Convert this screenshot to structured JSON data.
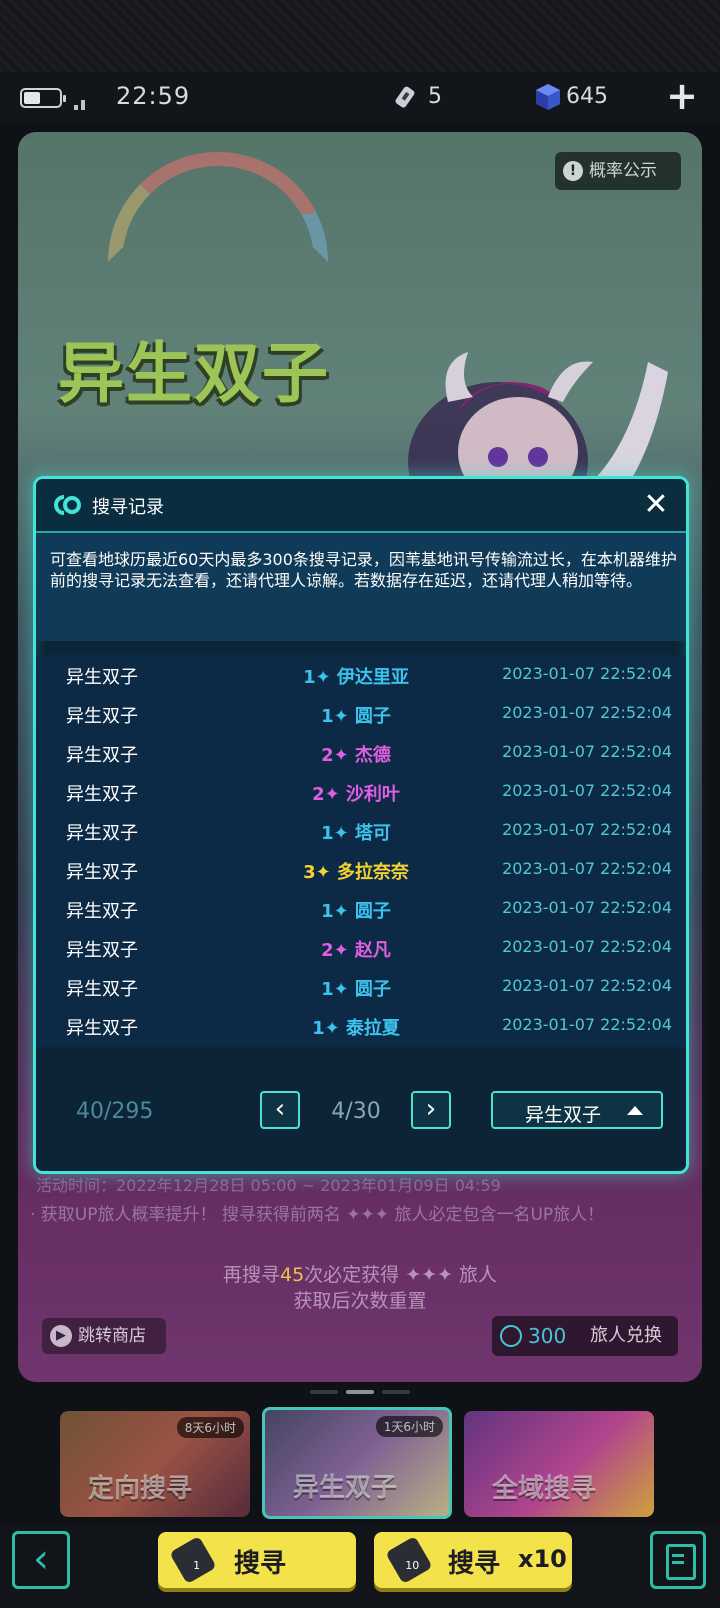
{
  "status": {
    "time": "22:59",
    "tickets": "5",
    "crystals": "645"
  },
  "banner": {
    "title": "异生双子",
    "probability_button": "概率公示",
    "event_time": "活动时间：2022年12月28日 05:00 ~ 2023年01月09日 04:59",
    "event_rule": "· 获取UP旅人概率提升！ 搜寻获得前两名 ✦✦✦ 旅人必定包含一名UP旅人！",
    "guarantee_prefix": "再搜寻",
    "guarantee_count": "45",
    "guarantee_suffix": "次必定获得 ✦✦✦ 旅人",
    "guarantee_note": "获取后次数重置",
    "shop_button": "跳转商店",
    "exchange_cost": "300",
    "exchange_button": "旅人兑换"
  },
  "dialog": {
    "title": "搜寻记录",
    "notice": "可查看地球历最近60天内最多300条搜寻记录，因苇基地讯号传输流过长，在本机器维护前的搜寻记录无法查看，还请代理人谅解。若数据存在延迟，还请代理人稍加等待。",
    "records": [
      {
        "pool": "异生双子",
        "result": "1✦ 伊达里亚",
        "rarity": 1,
        "time": "2023-01-07 22:52:04"
      },
      {
        "pool": "异生双子",
        "result": "1✦ 圆子",
        "rarity": 1,
        "time": "2023-01-07 22:52:04"
      },
      {
        "pool": "异生双子",
        "result": "2✦ 杰德",
        "rarity": 2,
        "time": "2023-01-07 22:52:04"
      },
      {
        "pool": "异生双子",
        "result": "2✦ 沙利叶",
        "rarity": 2,
        "time": "2023-01-07 22:52:04"
      },
      {
        "pool": "异生双子",
        "result": "1✦ 塔可",
        "rarity": 1,
        "time": "2023-01-07 22:52:04"
      },
      {
        "pool": "异生双子",
        "result": "3✦ 多拉奈奈",
        "rarity": 3,
        "time": "2023-01-07 22:52:04"
      },
      {
        "pool": "异生双子",
        "result": "1✦ 圆子",
        "rarity": 1,
        "time": "2023-01-07 22:52:04"
      },
      {
        "pool": "异生双子",
        "result": "2✦ 赵凡",
        "rarity": 2,
        "time": "2023-01-07 22:52:04"
      },
      {
        "pool": "异生双子",
        "result": "1✦ 圆子",
        "rarity": 1,
        "time": "2023-01-07 22:52:04"
      },
      {
        "pool": "异生双子",
        "result": "1✦ 泰拉夏",
        "rarity": 1,
        "time": "2023-01-07 22:52:04"
      }
    ],
    "count": "40/295",
    "page": "4/30",
    "pool_select": "异生双子"
  },
  "pool_tabs": [
    {
      "label": "定向搜寻",
      "badge": "8天6小时"
    },
    {
      "label": "异生双子",
      "badge": "1天6小时"
    },
    {
      "label": "全域搜寻",
      "badge": ""
    }
  ],
  "bottom": {
    "search_label": "搜寻",
    "search10_label": "搜寻",
    "search10_mult": "x10"
  },
  "colors": {
    "accent": "#43e3d6",
    "rarity1": "#3cc2ec",
    "rarity2": "#e15ee3",
    "rarity3": "#f5d233",
    "button_yellow": "#f3e24a"
  }
}
